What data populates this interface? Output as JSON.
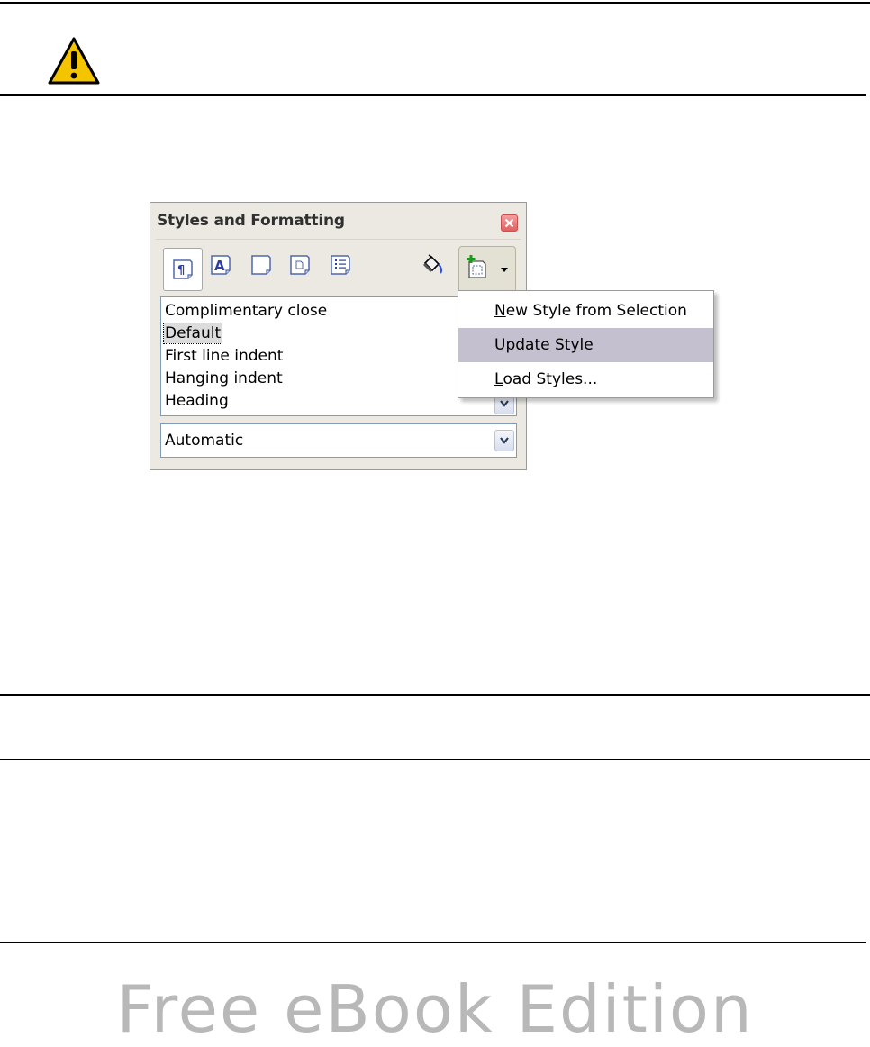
{
  "note_icon": "warning-icon",
  "dialog": {
    "title": "Styles and Formatting",
    "toolbar_icons": [
      "paragraph-styles-icon",
      "character-styles-icon",
      "frame-styles-icon",
      "page-styles-icon",
      "list-styles-icon",
      "fill-format-mode-icon",
      "new-style-icon"
    ],
    "styles_list": [
      {
        "label": "Complimentary close",
        "selected": false
      },
      {
        "label": "Default",
        "selected": true
      },
      {
        "label": "First line indent",
        "selected": false
      },
      {
        "label": "Hanging indent",
        "selected": false
      },
      {
        "label": "Heading",
        "selected": false
      }
    ],
    "filter": {
      "value": "Automatic"
    }
  },
  "menu": {
    "items": [
      {
        "mnemonic": "N",
        "rest": "ew Style from Selection",
        "highlighted": false
      },
      {
        "mnemonic": "U",
        "rest": "pdate Style",
        "highlighted": true
      },
      {
        "mnemonic": "L",
        "rest": "oad Styles...",
        "highlighted": false
      }
    ]
  },
  "watermark": "Free eBook Edition",
  "colors": {
    "highlight": "#c5c0cf",
    "close_button": "#e06060",
    "warning": "#f5c400"
  }
}
